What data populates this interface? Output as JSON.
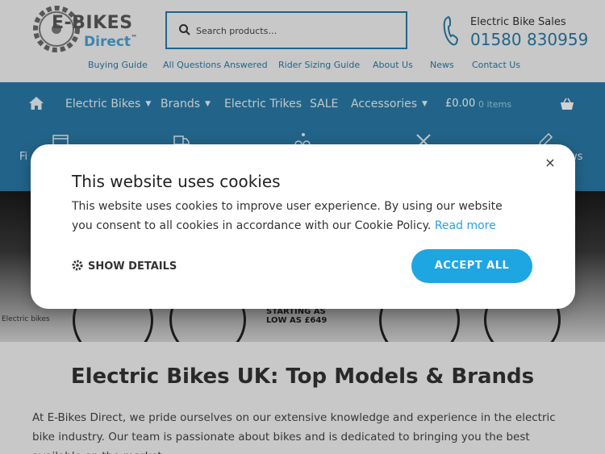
{
  "brand": {
    "name_top": "E-BIKES",
    "name_bottom": "Direct",
    "tm": "™"
  },
  "search": {
    "placeholder": "Search products…"
  },
  "contact": {
    "label": "Electric Bike Sales",
    "phone": "01580 830959"
  },
  "top_links": [
    "Buying Guide",
    "All Questions Answered",
    "Rider Sizing Guide",
    "About Us",
    "News",
    "Contact Us"
  ],
  "nav": {
    "items": [
      "Electric Bikes",
      "Brands",
      "Electric Trikes",
      "SALE",
      "Accessories"
    ],
    "cart_total": "£0.00",
    "cart_count": "0 items"
  },
  "features": {
    "partial_left": "Fi",
    "partial_right": "ws"
  },
  "hero": {
    "caption": "Electric bikes",
    "promo_line1": "STARTING AS",
    "promo_line2": "LOW AS £649"
  },
  "page": {
    "heading": "Electric Bikes UK: Top Models & Brands",
    "intro": "At E-Bikes Direct, we pride ourselves on our extensive knowledge and experience in the electric bike industry. Our team is passionate about bikes and is dedicated to bringing you the best available on the market."
  },
  "cookie_modal": {
    "title": "This website uses cookies",
    "body": "This website uses cookies to improve user experience. By using our website you consent to all cookies in accordance with our Cookie Policy.",
    "read_more": "Read more",
    "show_details": "SHOW DETAILS",
    "accept_all": "ACCEPT ALL",
    "close_symbol": "×"
  },
  "colors": {
    "primary": "#2a7ba8",
    "accent": "#1ea6e3",
    "background": "#f4f4f4"
  }
}
